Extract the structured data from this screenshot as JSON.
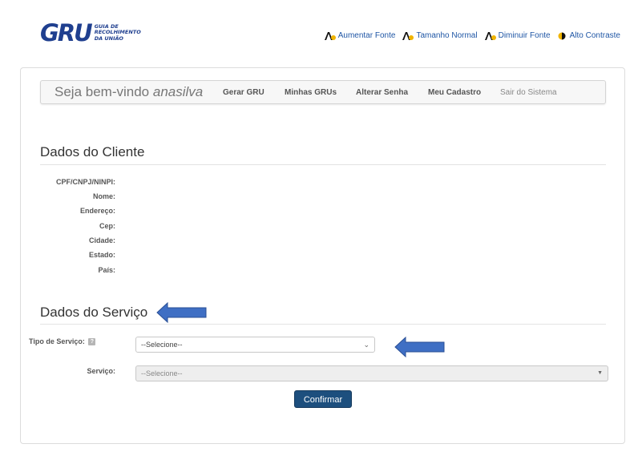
{
  "header": {
    "logo_mark": "GRU",
    "logo_lines": [
      "GUIA DE",
      "RECOLHIMENTO",
      "DA UNIÃO"
    ],
    "accessibility": [
      {
        "label": "Aumentar Fonte",
        "icon": "increase-font-icon"
      },
      {
        "label": "Tamanho Normal",
        "icon": "normal-font-icon"
      },
      {
        "label": "Diminuir Fonte",
        "icon": "decrease-font-icon"
      },
      {
        "label": "Alto Contraste",
        "icon": "contrast-icon"
      }
    ]
  },
  "nav": {
    "welcome_prefix": "Seja bem-vindo",
    "username": "anasilva",
    "links": [
      "Gerar GRU",
      "Minhas GRUs",
      "Alterar Senha",
      "Meu Cadastro"
    ],
    "logout": "Sair do Sistema"
  },
  "cliente": {
    "title": "Dados do Cliente",
    "fields": [
      "CPF/CNPJ/NINPI:",
      "Nome:",
      "Endereço:",
      "Cep:",
      "Cidade:",
      "Estado:",
      "País:"
    ]
  },
  "servico": {
    "title": "Dados do Serviço",
    "tipo_label": "Tipo de Serviço:",
    "help_icon": "?",
    "tipo_value": "--Selecione--",
    "servico_label": "Serviço:",
    "servico_value": "--Selecione--"
  },
  "confirm_label": "Confirmar",
  "colors": {
    "brand": "#1f3f8f",
    "link": "#1f56a5",
    "button": "#1d4f7e",
    "arrow": "#3f6fc4"
  }
}
